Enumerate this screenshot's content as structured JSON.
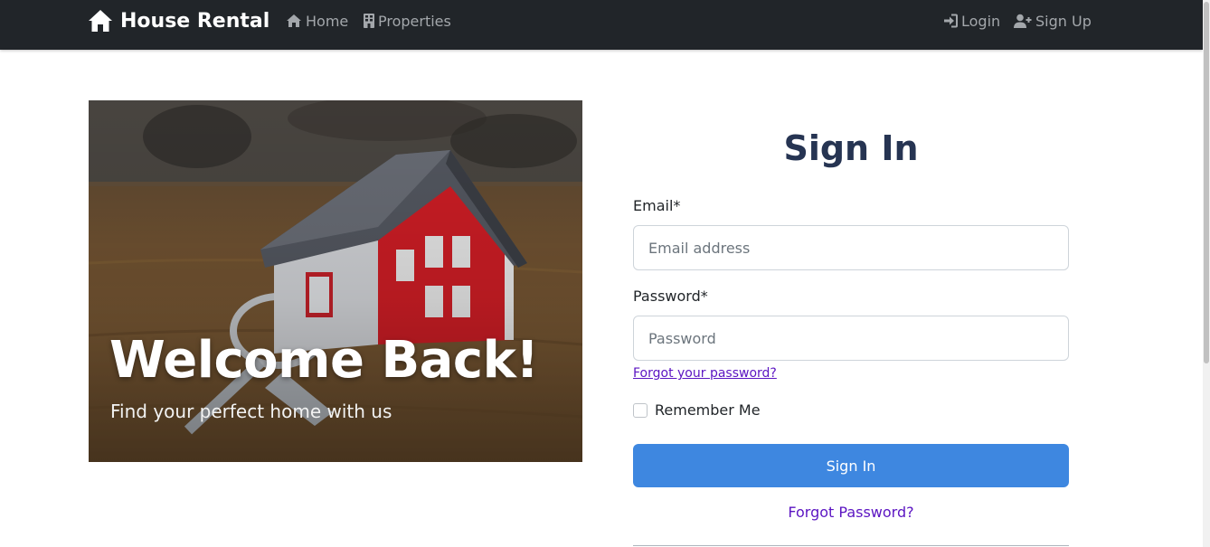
{
  "navbar": {
    "brand": "House Rental",
    "links": [
      {
        "label": "Home",
        "icon": "house-icon"
      },
      {
        "label": "Properties",
        "icon": "building-icon"
      }
    ],
    "auth": [
      {
        "label": "Login",
        "icon": "login-icon"
      },
      {
        "label": "Sign Up",
        "icon": "user-plus-icon"
      }
    ]
  },
  "hero": {
    "title": "Welcome Back!",
    "subtitle": "Find your perfect home with us"
  },
  "form": {
    "title": "Sign In",
    "email_label": "Email*",
    "email_placeholder": "Email address",
    "email_value": "",
    "password_label": "Password*",
    "password_placeholder": "Password",
    "password_value": "",
    "forgot_inline": "Forgot your password?",
    "remember_label": "Remember Me",
    "remember_checked": false,
    "submit_label": "Sign In",
    "forgot_link": "Forgot Password?"
  },
  "colors": {
    "navbar_bg": "#212529",
    "primary_button": "#3e87e0",
    "title": "#263452",
    "link": "#5b14c2"
  }
}
